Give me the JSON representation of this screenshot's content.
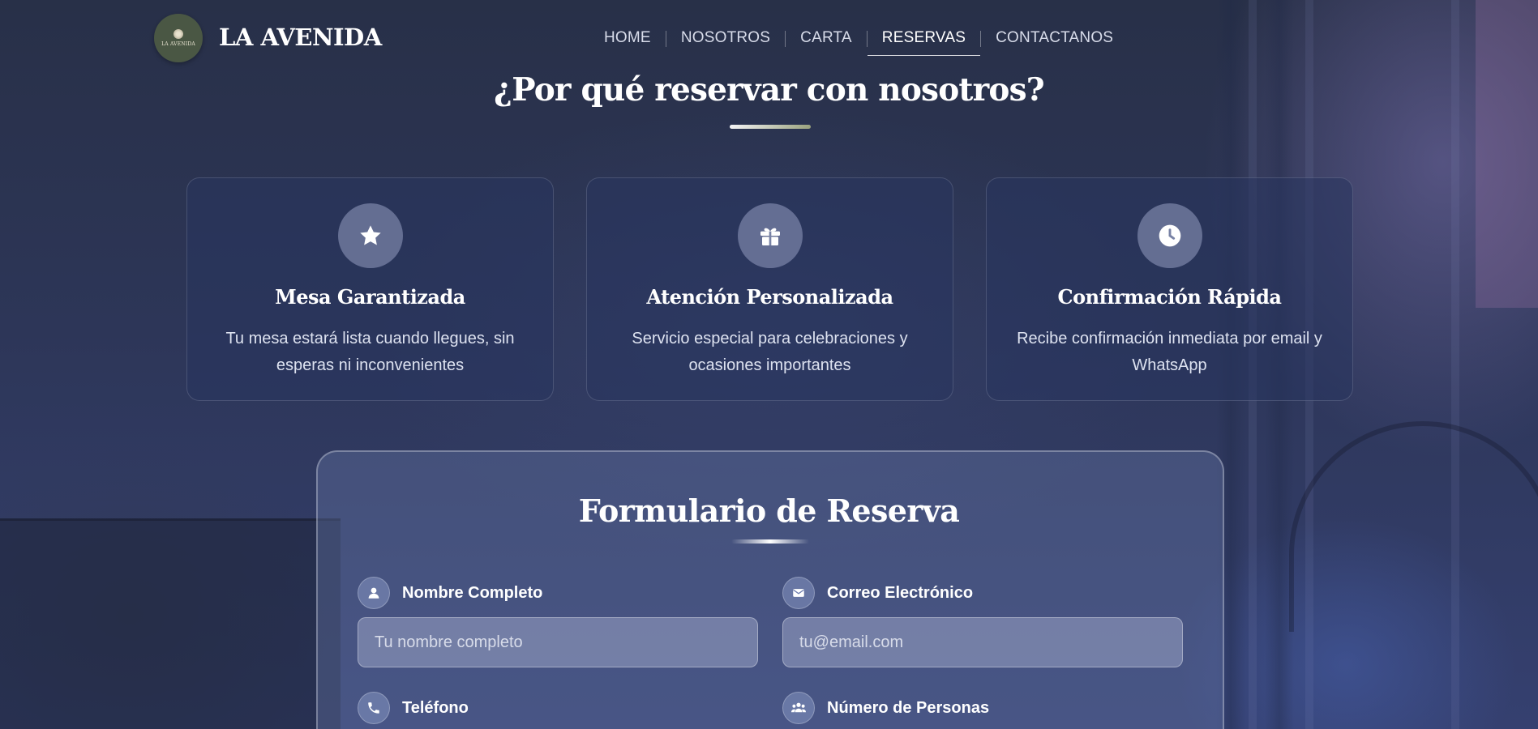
{
  "header": {
    "logo_text": "LA AVENIDA",
    "brand": "LA AVENIDA",
    "nav": [
      {
        "label": "HOME"
      },
      {
        "label": "NOSOTROS"
      },
      {
        "label": "CARTA"
      },
      {
        "label": "RESERVAS",
        "active": true
      },
      {
        "label": "CONTACTANOS"
      }
    ]
  },
  "why": {
    "title": "¿Por qué reservar con nosotros?",
    "cards": [
      {
        "icon": "star-icon",
        "title": "Mesa Garantizada",
        "text": "Tu mesa estará lista cuando llegues, sin esperas ni inconvenientes"
      },
      {
        "icon": "gift-icon",
        "title": "Atención Personalizada",
        "text": "Servicio especial para celebraciones y ocasiones importantes"
      },
      {
        "icon": "clock-icon",
        "title": "Confirmación Rápida",
        "text": "Recibe confirmación inmediata por email y WhatsApp"
      }
    ]
  },
  "form": {
    "title": "Formulario de Reserva",
    "fields": [
      {
        "icon": "user-icon",
        "label": "Nombre Completo",
        "placeholder": "Tu nombre completo",
        "value": ""
      },
      {
        "icon": "envelope-icon",
        "label": "Correo Electrónico",
        "placeholder": "tu@email.com",
        "value": ""
      },
      {
        "icon": "phone-icon",
        "label": "Teléfono"
      },
      {
        "icon": "users-icon",
        "label": "Número de Personas"
      }
    ]
  },
  "colors": {
    "background": "#2d3658",
    "accent_underline": "#9aa27e",
    "logo_bg": "#4a5744"
  }
}
